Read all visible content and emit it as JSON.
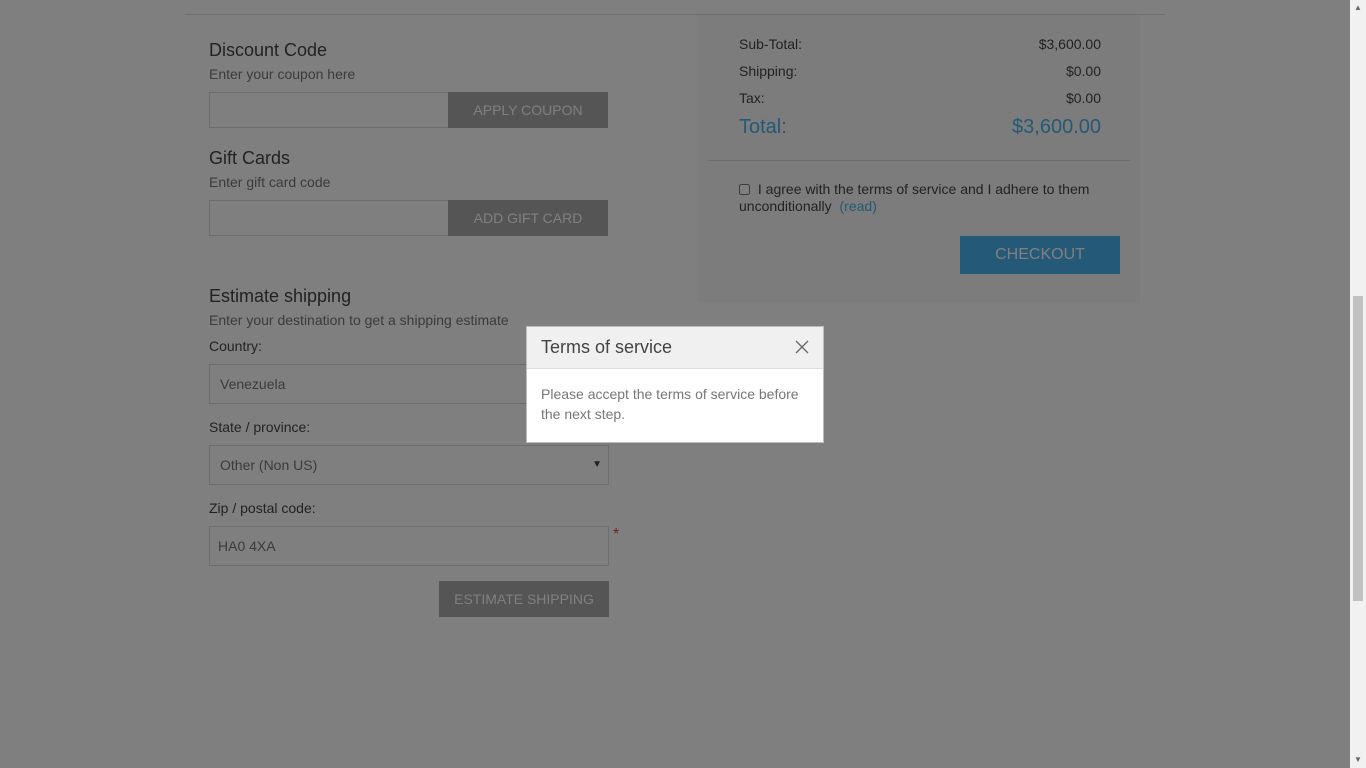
{
  "discount": {
    "title": "Discount Code",
    "hint": "Enter your coupon here",
    "input_value": "",
    "button_label": "APPLY COUPON"
  },
  "giftcard": {
    "title": "Gift Cards",
    "hint": "Enter gift card code",
    "input_value": "",
    "button_label": "ADD GIFT CARD"
  },
  "shipping": {
    "title": "Estimate shipping",
    "hint": "Enter your destination to get a shipping estimate",
    "country_label": "Country:",
    "country_value": "Venezuela",
    "state_label": "State / province:",
    "state_value": "Other (Non US)",
    "zip_label": "Zip / postal code:",
    "zip_value": "HA0 4XA",
    "required_mark": "*",
    "button_label": "ESTIMATE SHIPPING"
  },
  "totals": {
    "subtotal_label": "Sub-Total:",
    "subtotal_value": "$3,600.00",
    "shipping_label": "Shipping:",
    "shipping_value": "$0.00",
    "tax_label": "Tax:",
    "tax_value": "$0.00",
    "total_label": "Total:",
    "total_value": "$3,600.00"
  },
  "terms": {
    "checkbox_text": "I agree with the terms of service and I adhere to them unconditionally",
    "read_link": "(read)",
    "checked": false
  },
  "checkout": {
    "button_label": "CHECKOUT"
  },
  "dialog": {
    "title": "Terms of service",
    "message": "Please accept the terms of service before the next step.",
    "close_icon": "close-icon"
  },
  "colors": {
    "accent": "#4ab2f1",
    "overlay": "rgba(0,0,0,0.5)",
    "required": "#e4434b"
  }
}
